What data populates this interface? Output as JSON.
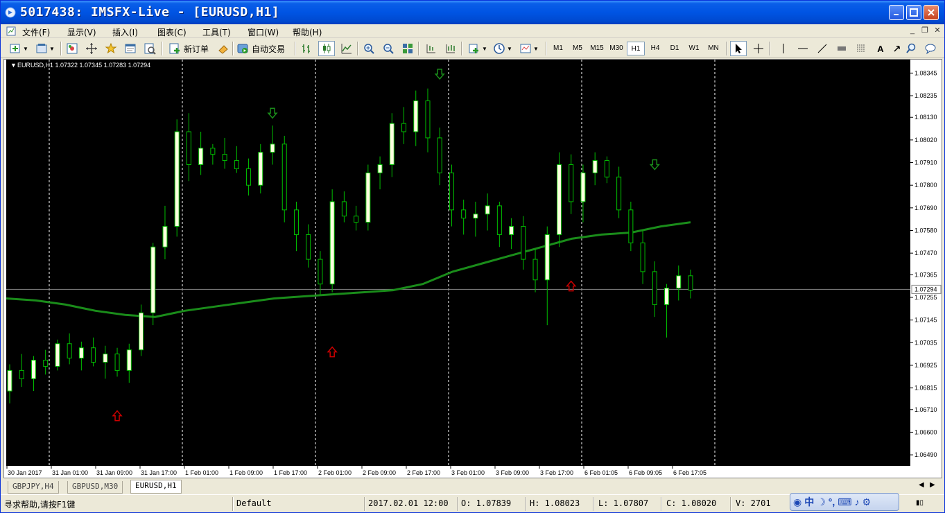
{
  "window": {
    "title": "5017438: IMSFX-Live - [EURUSD,H1]"
  },
  "menu": [
    "文件(F)",
    "显示(V)",
    "插入(I)",
    "图表(C)",
    "工具(T)",
    "窗口(W)",
    "帮助(H)"
  ],
  "toolbar": {
    "new_order_label": "新订单",
    "auto_trading_label": "自动交易",
    "timeframes": [
      "M1",
      "M5",
      "M15",
      "M30",
      "H1",
      "H4",
      "D1",
      "W1",
      "MN"
    ],
    "active_timeframe": "H1",
    "icons": [
      "new-chart-icon",
      "profiles-icon",
      "market-watch-icon",
      "navigator-icon",
      "favorites-icon",
      "terminal-icon",
      "strategy-tester-icon",
      "new-order-icon",
      "metaeditor-icon",
      "auto-trading-icon",
      "bar-chart-icon",
      "candlestick-icon",
      "line-chart-icon",
      "zoom-in-icon",
      "zoom-out-icon",
      "tile-windows-icon",
      "chart-shift-icon",
      "autoscroll-icon",
      "indicators-icon",
      "periods-icon",
      "templates-icon",
      "cursor-icon",
      "crosshair-icon",
      "vertical-line-icon",
      "horizontal-line-icon",
      "trendline-icon",
      "channel-icon",
      "fibonacci-icon",
      "text-icon",
      "arrows-icon",
      "search-icon",
      "chat-icon"
    ]
  },
  "chart_data": {
    "type": "candlestick",
    "symbol_header": "EURUSD,H1  1.07322 1.07345 1.07283 1.07294",
    "background": "#000000",
    "bull_color": "#ffffe0",
    "bear_color": "#000000",
    "wick_color": "#00c000",
    "ma_color": "#1a8c1a",
    "current_price_label": "1.07294",
    "current_price": 1.07294,
    "ylim": [
      1.0646,
      1.0838
    ],
    "y_ticks": [
      "1.08345",
      "1.08235",
      "1.08130",
      "1.08020",
      "1.07910",
      "1.07800",
      "1.07690",
      "1.07580",
      "1.07470",
      "1.07365",
      "1.07255",
      "1.07145",
      "1.07035",
      "1.06925",
      "1.06815",
      "1.06710",
      "1.06600",
      "1.06490"
    ],
    "x_ticks": [
      "30 Jan 2017",
      "31 Jan 01:00",
      "31 Jan 09:00",
      "31 Jan 17:00",
      "1 Feb 01:00",
      "1 Feb 09:00",
      "1 Feb 17:00",
      "2 Feb 01:00",
      "2 Feb 09:00",
      "2 Feb 17:00",
      "3 Feb 01:00",
      "3 Feb 09:00",
      "3 Feb 17:00",
      "6 Feb 01:05",
      "6 Feb 09:05",
      "6 Feb 17:05"
    ],
    "period_separators_after_tick": [
      1,
      4,
      7,
      10,
      13,
      16
    ],
    "ma_points": [
      1.0725,
      1.0724,
      1.0722,
      1.0719,
      1.0717,
      1.0716,
      1.0719,
      1.0721,
      1.0723,
      1.0725,
      1.0726,
      1.0727,
      1.0728,
      1.0729,
      1.0732,
      1.0738,
      1.0742,
      1.0746,
      1.075,
      1.0754,
      1.0756,
      1.0757,
      1.076,
      1.0762
    ],
    "candles": [
      [
        1.068,
        1.0693,
        1.0674,
        1.069
      ],
      [
        1.069,
        1.0698,
        1.0682,
        1.0686
      ],
      [
        1.0686,
        1.0697,
        1.068,
        1.0695
      ],
      [
        1.0695,
        1.07,
        1.0688,
        1.0692
      ],
      [
        1.0692,
        1.0705,
        1.069,
        1.0703
      ],
      [
        1.0703,
        1.0708,
        1.0693,
        1.0696
      ],
      [
        1.0696,
        1.0704,
        1.069,
        1.0701
      ],
      [
        1.0701,
        1.0706,
        1.0692,
        1.0694
      ],
      [
        1.0694,
        1.0702,
        1.0686,
        1.0698
      ],
      [
        1.0698,
        1.0701,
        1.0687,
        1.069
      ],
      [
        1.069,
        1.0703,
        1.0684,
        1.07
      ],
      [
        1.07,
        1.0722,
        1.0697,
        1.0718
      ],
      [
        1.0718,
        1.0752,
        1.0712,
        1.075
      ],
      [
        1.075,
        1.077,
        1.0744,
        1.076
      ],
      [
        1.076,
        1.0812,
        1.0755,
        1.0806
      ],
      [
        1.0806,
        1.0815,
        1.0782,
        1.079
      ],
      [
        1.079,
        1.0806,
        1.0785,
        1.0798
      ],
      [
        1.0798,
        1.08,
        1.079,
        1.0795
      ],
      [
        1.0795,
        1.0803,
        1.0788,
        1.0792
      ],
      [
        1.0792,
        1.0799,
        1.0786,
        1.0788
      ],
      [
        1.0788,
        1.0793,
        1.0775,
        1.078
      ],
      [
        1.078,
        1.08,
        1.0776,
        1.0796
      ],
      [
        1.0796,
        1.0809,
        1.079,
        1.08
      ],
      [
        1.08,
        1.0804,
        1.0762,
        1.0768
      ],
      [
        1.0768,
        1.0772,
        1.0748,
        1.0756
      ],
      [
        1.0756,
        1.0761,
        1.074,
        1.0744
      ],
      [
        1.0744,
        1.0748,
        1.0727,
        1.0732
      ],
      [
        1.0732,
        1.0778,
        1.0728,
        1.0772
      ],
      [
        1.0772,
        1.0777,
        1.0762,
        1.0765
      ],
      [
        1.0765,
        1.077,
        1.0758,
        1.0762
      ],
      [
        1.0762,
        1.079,
        1.0758,
        1.0786
      ],
      [
        1.0786,
        1.0794,
        1.0778,
        1.079
      ],
      [
        1.079,
        1.0815,
        1.0784,
        1.081
      ],
      [
        1.081,
        1.0818,
        1.08,
        1.0806
      ],
      [
        1.0806,
        1.0826,
        1.0799,
        1.0821
      ],
      [
        1.0821,
        1.0827,
        1.0796,
        1.0803
      ],
      [
        1.0803,
        1.0808,
        1.078,
        1.0786
      ],
      [
        1.0786,
        1.079,
        1.076,
        1.0768
      ],
      [
        1.0768,
        1.0773,
        1.0756,
        1.0764
      ],
      [
        1.0764,
        1.0772,
        1.0755,
        1.0766
      ],
      [
        1.0766,
        1.0776,
        1.0758,
        1.077
      ],
      [
        1.077,
        1.0772,
        1.075,
        1.0756
      ],
      [
        1.0756,
        1.0764,
        1.0749,
        1.076
      ],
      [
        1.076,
        1.0765,
        1.0739,
        1.0744
      ],
      [
        1.0744,
        1.0749,
        1.0728,
        1.0734
      ],
      [
        1.0734,
        1.076,
        1.0712,
        1.0756
      ],
      [
        1.0756,
        1.0796,
        1.075,
        1.079
      ],
      [
        1.079,
        1.0795,
        1.0766,
        1.0772
      ],
      [
        1.0772,
        1.079,
        1.0762,
        1.0786
      ],
      [
        1.0786,
        1.0796,
        1.078,
        1.0792
      ],
      [
        1.0792,
        1.0794,
        1.0781,
        1.0784
      ],
      [
        1.0784,
        1.0789,
        1.0764,
        1.0768
      ],
      [
        1.0768,
        1.0772,
        1.0748,
        1.0752
      ],
      [
        1.0752,
        1.0758,
        1.0732,
        1.0738
      ],
      [
        1.0738,
        1.0743,
        1.0716,
        1.0722
      ],
      [
        1.0722,
        1.0732,
        1.0706,
        1.073
      ],
      [
        1.073,
        1.0741,
        1.0724,
        1.0736
      ],
      [
        1.0736,
        1.0739,
        1.0725,
        1.0729
      ]
    ],
    "arrows": [
      {
        "dir": "up",
        "color": "#cc0000",
        "candle": 9,
        "price": 1.0668
      },
      {
        "dir": "down",
        "color": "#1a8c1a",
        "candle": 22,
        "price": 1.0815
      },
      {
        "dir": "up",
        "color": "#cc0000",
        "candle": 27,
        "price": 1.0699
      },
      {
        "dir": "down",
        "color": "#1a8c1a",
        "candle": 36,
        "price": 1.0834
      },
      {
        "dir": "up",
        "color": "#cc0000",
        "candle": 47,
        "price": 1.0731
      },
      {
        "dir": "down",
        "color": "#1a8c1a",
        "candle": 54,
        "price": 1.079
      }
    ]
  },
  "tabs": [
    {
      "label": "GBPJPY,H4",
      "active": false
    },
    {
      "label": "GBPUSD,M30",
      "active": false
    },
    {
      "label": "EURUSD,H1",
      "active": true
    }
  ],
  "status": {
    "help": "寻求帮助,请按F1键",
    "profile": "Default",
    "datetime": "2017.02.01 12:00",
    "open": "O: 1.07839",
    "high": "H: 1.08023",
    "low": "L: 1.07807",
    "close": "C: 1.08020",
    "volume": "V: 2701"
  }
}
